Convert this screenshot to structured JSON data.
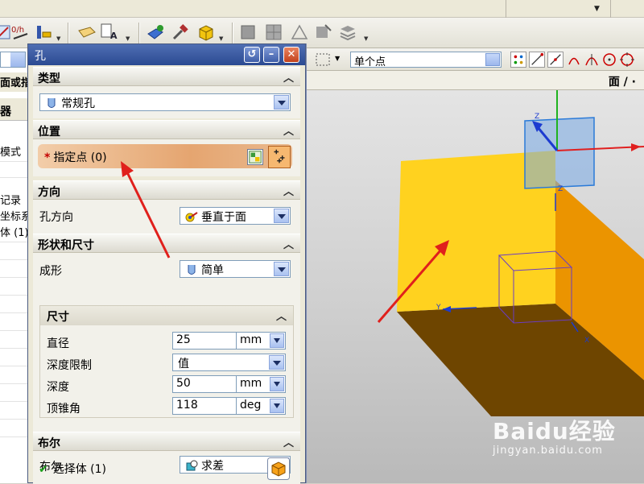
{
  "dialog": {
    "title": "孔",
    "groups": {
      "type": {
        "header": "类型",
        "value": "常规孔"
      },
      "position": {
        "header": "位置",
        "specify_point": "指定点 (0)",
        "required_mark": "*"
      },
      "direction": {
        "header": "方向",
        "label": "孔方向",
        "value": "垂直于面"
      },
      "shape": {
        "header": "形状和尺寸",
        "form_label": "成形",
        "form_value": "简单",
        "dimensions": {
          "header": "尺寸",
          "diameter": {
            "label": "直径",
            "value": "25",
            "unit": "mm"
          },
          "depth_limit": {
            "label": "深度限制",
            "value": "值"
          },
          "depth": {
            "label": "深度",
            "value": "50",
            "unit": "mm"
          },
          "tip_angle": {
            "label": "顶锥角",
            "value": "118",
            "unit": "deg"
          }
        }
      },
      "boolean": {
        "header": "布尔",
        "label": "布尔",
        "value": "求差",
        "select_body": "选择体 (1)"
      }
    }
  },
  "toolbar2": {
    "selection_filter": "单个点"
  },
  "right_header": {
    "text": "面 / ·"
  },
  "navigator": {
    "title": "面或指",
    "column": "器",
    "rows": [
      "模式",
      "记录",
      "坐标系",
      "体 (1)"
    ]
  },
  "viewport": {
    "axis_labels": {
      "z": "Z",
      "y": "Y",
      "x": "X"
    }
  },
  "watermark": {
    "main": "Baidu经验",
    "sub": "jingyan.baidu.com"
  },
  "colors": {
    "cube_top": "#ffd21f",
    "cube_right": "#eb9400",
    "cube_bottom": "#6b4300",
    "title_bar": "#2b4a92",
    "highlight": "#e5a570",
    "arrow": "#e0201c"
  }
}
